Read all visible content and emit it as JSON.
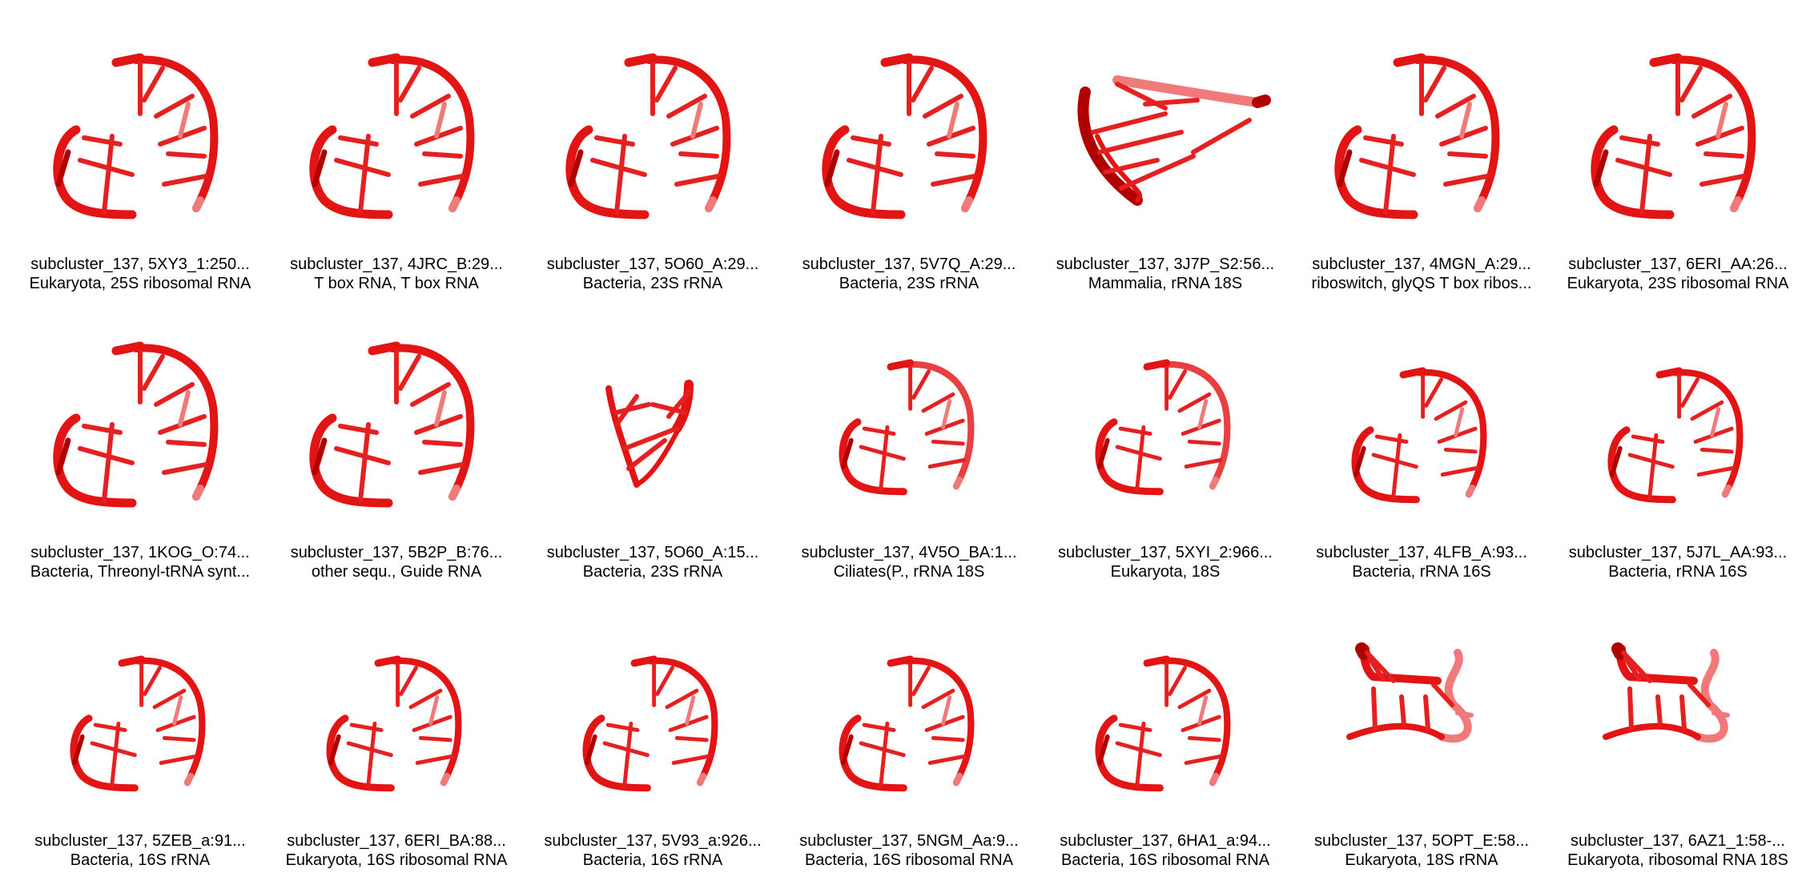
{
  "colors": {
    "backbone": "#e31414",
    "backbone_dark": "#b00000",
    "base": "#e52020",
    "base_light": "#f07a7a"
  },
  "panels": [
    {
      "id": "5XY3_1",
      "line1": "subcluster_137, 5XY3_1:250...",
      "line2": "Eukaryota, 25S ribosomal RNA",
      "shape": "full"
    },
    {
      "id": "4JRC_B",
      "line1": "subcluster_137, 4JRC_B:29...",
      "line2": "T box RNA, T box RNA",
      "shape": "full"
    },
    {
      "id": "5O60_A_29",
      "line1": "subcluster_137, 5O60_A:29...",
      "line2": "Bacteria, 23S rRNA",
      "shape": "full"
    },
    {
      "id": "5V7Q_A",
      "line1": "subcluster_137, 5V7Q_A:29...",
      "line2": "Bacteria, 23S rRNA",
      "shape": "full"
    },
    {
      "id": "3J7P_S2",
      "line1": "subcluster_137, 3J7P_S2:56...",
      "line2": "Mammalia, rRNA 18S",
      "shape": "twisted"
    },
    {
      "id": "4MGN_A",
      "line1": "subcluster_137, 4MGN_A:29...",
      "line2": "riboswitch, glyQS T box ribos...",
      "shape": "full"
    },
    {
      "id": "6ERI_AA",
      "line1": "subcluster_137, 6ERI_AA:26...",
      "line2": "Eukaryota, 23S ribosomal RNA",
      "shape": "full"
    },
    {
      "id": "1KOG_O",
      "line1": "subcluster_137, 1KOG_O:74...",
      "line2": "Bacteria, Threonyl-tRNA synt...",
      "shape": "full"
    },
    {
      "id": "5B2P_B",
      "line1": "subcluster_137, 5B2P_B:76...",
      "line2": "other sequ., Guide RNA",
      "shape": "full"
    },
    {
      "id": "5O60_A_15",
      "line1": "subcluster_137, 5O60_A:15...",
      "line2": "Bacteria, 23S rRNA",
      "shape": "vshape"
    },
    {
      "id": "4V5O_BA",
      "line1": "subcluster_137, 4V5O_BA:1...",
      "line2": "Ciliates(P., rRNA 18S",
      "shape": "light"
    },
    {
      "id": "5XYI_2",
      "line1": "subcluster_137, 5XYI_2:966...",
      "line2": "Eukaryota, 18S",
      "shape": "light"
    },
    {
      "id": "4LFB_A",
      "line1": "subcluster_137, 4LFB_A:93...",
      "line2": "Bacteria, rRNA 16S",
      "shape": "small"
    },
    {
      "id": "5J7L_AA",
      "line1": "subcluster_137, 5J7L_AA:93...",
      "line2": "Bacteria, rRNA 16S",
      "shape": "small"
    },
    {
      "id": "5ZEB_a",
      "line1": "subcluster_137, 5ZEB_a:91...",
      "line2": "Bacteria, 16S rRNA",
      "shape": "small"
    },
    {
      "id": "6ERI_BA",
      "line1": "subcluster_137, 6ERI_BA:88...",
      "line2": "Eukaryota, 16S ribosomal RNA",
      "shape": "small"
    },
    {
      "id": "5V93_a",
      "line1": "subcluster_137, 5V93_a:926...",
      "line2": "Bacteria, 16S rRNA",
      "shape": "small"
    },
    {
      "id": "5NGM_Aa",
      "line1": "subcluster_137, 5NGM_Aa:9...",
      "line2": "Bacteria, 16S ribosomal RNA",
      "shape": "small"
    },
    {
      "id": "6HA1_a",
      "line1": "subcluster_137, 6HA1_a:94...",
      "line2": "Bacteria, 16S ribosomal RNA",
      "shape": "small"
    },
    {
      "id": "5OPT_E",
      "line1": "subcluster_137, 5OPT_E:58...",
      "line2": "Eukaryota, 18S rRNA",
      "shape": "flat"
    },
    {
      "id": "6AZ1_1",
      "line1": "subcluster_137, 6AZ1_1:58-...",
      "line2": "Eukaryota, ribosomal RNA 18S",
      "shape": "flat"
    }
  ]
}
